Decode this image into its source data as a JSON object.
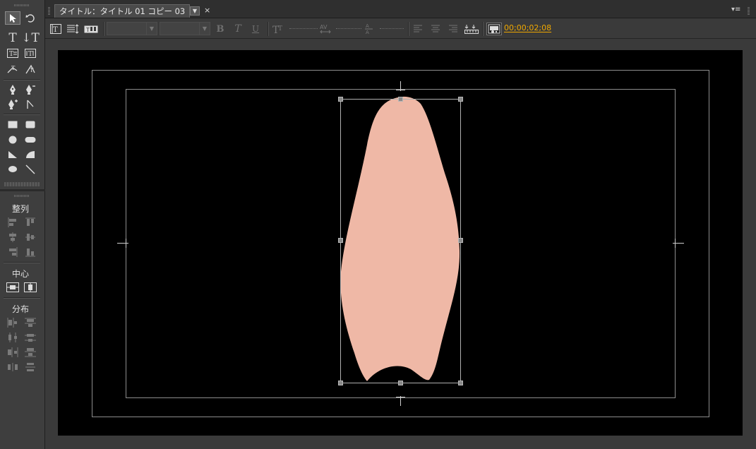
{
  "tab": {
    "title": "タイトル：タイトル 01 コピー 03",
    "menu_glyph": "▼",
    "close_glyph": "×"
  },
  "panel_menu_glyph": "▾≡",
  "toolbar": {
    "timecode": "00;00;02;08",
    "font_family_value": "",
    "font_style_value": "",
    "bold_label": "B",
    "italic_label": "T",
    "underline_label": "U"
  },
  "tools_panel": {
    "align_heading": "整列",
    "center_heading": "中心",
    "distribute_heading": "分布"
  },
  "colors": {
    "shape_fill": "#efb8a6",
    "canvas_bg": "#000000",
    "timecode": "#f0a800",
    "safe_margin": "#8d8d8d"
  },
  "icons": [
    "selection-tool-icon",
    "rotation-tool-icon",
    "type-tool-icon",
    "vertical-type-tool-icon",
    "area-type-tool-icon",
    "vertical-area-type-tool-icon",
    "path-type-tool-icon",
    "vertical-path-type-tool-icon",
    "pen-tool-icon",
    "delete-anchor-point-icon",
    "add-anchor-point-icon",
    "convert-anchor-point-icon",
    "rectangle-tool-icon",
    "rounded-rectangle-tool-icon",
    "ellipse-tool-icon",
    "rounded-corner-rectangle-tool-icon",
    "wedge-tool-icon",
    "arc-tool-icon",
    "ellipse-tool-icon-2",
    "line-tool-icon"
  ]
}
